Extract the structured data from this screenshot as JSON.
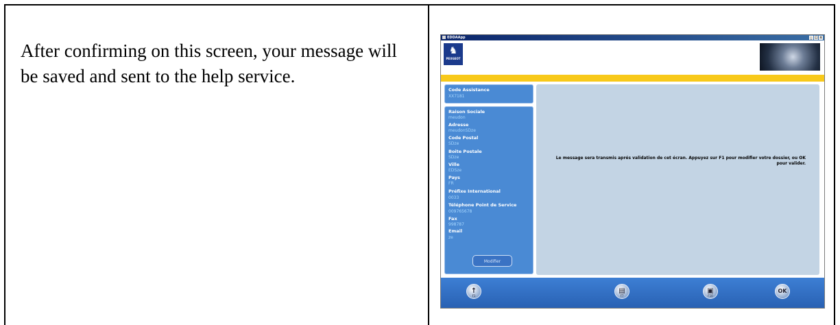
{
  "description": "After confirming on this screen, your message will be saved and sent to the help service.",
  "app": {
    "title": "EDDAApp",
    "brand": "PEUGEOT",
    "fields": [
      {
        "label": "Code Assistance",
        "value": "XX7181"
      },
      {
        "label": "Raison Sociale",
        "value": "meudon"
      },
      {
        "label": "Adresse",
        "value": "meudonSDze"
      },
      {
        "label": "Code Postal",
        "value": "SDze"
      },
      {
        "label": "Boite Postale",
        "value": "SDze"
      },
      {
        "label": "Ville",
        "value": "EDSze"
      },
      {
        "label": "Pays",
        "value": "FR"
      },
      {
        "label": "Préfixe International",
        "value": "0033"
      },
      {
        "label": "Téléphone Point de Service",
        "value": "009765678"
      },
      {
        "label": "Fax",
        "value": "998787"
      },
      {
        "label": "Email",
        "value": "ze"
      }
    ],
    "modifier_label": "Modifier",
    "message": "Le message sera transmis aprés validation de cet écran. Appuyez sur F1 pour modifier votre dossier, ou OK pour valider.",
    "buttons": [
      {
        "name": "f1-button",
        "glyph": "↑",
        "sub": "F1"
      },
      {
        "name": "f7-button",
        "glyph": "▤",
        "sub": "F7"
      },
      {
        "name": "f10-button",
        "glyph": "▣",
        "sub": "F10"
      },
      {
        "name": "ok-button",
        "glyph": "OK",
        "sub": ""
      }
    ]
  }
}
